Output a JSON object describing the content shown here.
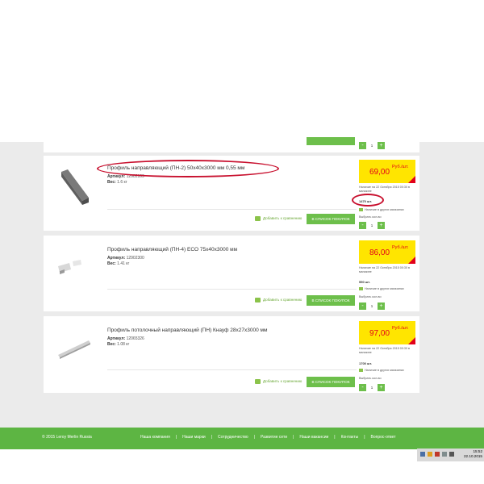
{
  "products": [
    {
      "title": "Профиль направляющий (ПН-2) 50x40x3000 мм 0,55 мм",
      "article_label": "Артикул:",
      "article": "12902109",
      "weight_label": "Вес:",
      "weight": "1.6 кг",
      "price": "69,00",
      "price_unit": "Руб./шт.",
      "availability": "Наличие на 22 Октября 2015 00:30 в магазине",
      "qty": "1470 шт.",
      "other_stores": "Наличие в других магазинах",
      "select_qty": "Выбрать кол-во",
      "stepper_value": "1",
      "compare": "Добавить к сравнению",
      "buy": "В СПИСОК ПОКУПОК"
    },
    {
      "title": "Профиль направляющий (ПН-4) ECO 75x40x3000 мм",
      "article_label": "Артикул:",
      "article": "12902300",
      "weight_label": "Вес:",
      "weight": "1.41 кг",
      "price": "86,00",
      "price_unit": "Руб./шт.",
      "availability": "Наличие на 22 Октября 2015 00:30 в магазине",
      "qty": "550 шт.",
      "other_stores": "Наличие в других магазинах",
      "select_qty": "Выбрать кол-во",
      "stepper_value": "1",
      "compare": "Добавить к сравнению",
      "buy": "В СПИСОК ПОКУПОК"
    },
    {
      "title": "Профиль потолочный направляющий (ПН) Кнауф 28x27x3000 мм",
      "article_label": "Артикул:",
      "article": "12065326",
      "weight_label": "Вес:",
      "weight": "1.08 кг",
      "price": "97,00",
      "price_unit": "Руб./шт.",
      "availability": "Наличие на 22 Октября 2015 00:30 в магазине",
      "qty": "1700 шт.",
      "other_stores": "Наличие в других магазинах",
      "select_qty": "Выбрать кол-во",
      "stepper_value": "1",
      "compare": "Добавить к сравнению",
      "buy": "В СПИСОК ПОКУПОК"
    }
  ],
  "stepper_symbols": {
    "minus": "-",
    "plus": "+"
  },
  "footer": {
    "copyright": "© 2015 Leroy Merlin Russia",
    "links": [
      "Наша компания",
      "Наши марки",
      "Сотрудничество",
      "Развитие сети",
      "Наши вакансии",
      "Контакты",
      "Вопрос-ответ"
    ],
    "separator": "|"
  },
  "taskbar": {
    "time": "15:52",
    "date": "22.10.2015"
  },
  "colors": {
    "brand_green": "#6dbf4b",
    "price_yellow": "#ffe500",
    "price_red": "#e2001a",
    "annotation_red": "#c8102e"
  }
}
